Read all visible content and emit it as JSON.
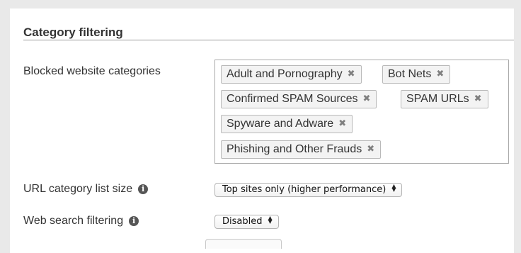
{
  "section": {
    "title": "Category filtering"
  },
  "blocked_categories": {
    "label": "Blocked website categories",
    "tags": [
      {
        "label": "Adult and Pornography",
        "remove": "✖"
      },
      {
        "label": "Bot Nets",
        "remove": "✖"
      },
      {
        "label": "Confirmed SPAM Sources",
        "remove": "✖"
      },
      {
        "label": "SPAM URLs",
        "remove": "✖"
      },
      {
        "label": "Spyware and Adware",
        "remove": "✖"
      },
      {
        "label": "Phishing and Other Frauds",
        "remove": "✖"
      }
    ]
  },
  "url_list_size": {
    "label": "URL category list size",
    "info_icon": "i",
    "selected": "Top sites only (higher performance)"
  },
  "web_search": {
    "label": "Web search filtering",
    "info_icon": "i",
    "selected": "Disabled"
  },
  "icons": {
    "remove_tag": "close-icon",
    "info": "info-circle-icon",
    "select": "updown-arrows-icon"
  },
  "colors": {
    "page_bg": "#e9e9e9",
    "panel_bg": "#ffffff",
    "tag_bg": "#f3f3f3",
    "text": "#333333"
  }
}
